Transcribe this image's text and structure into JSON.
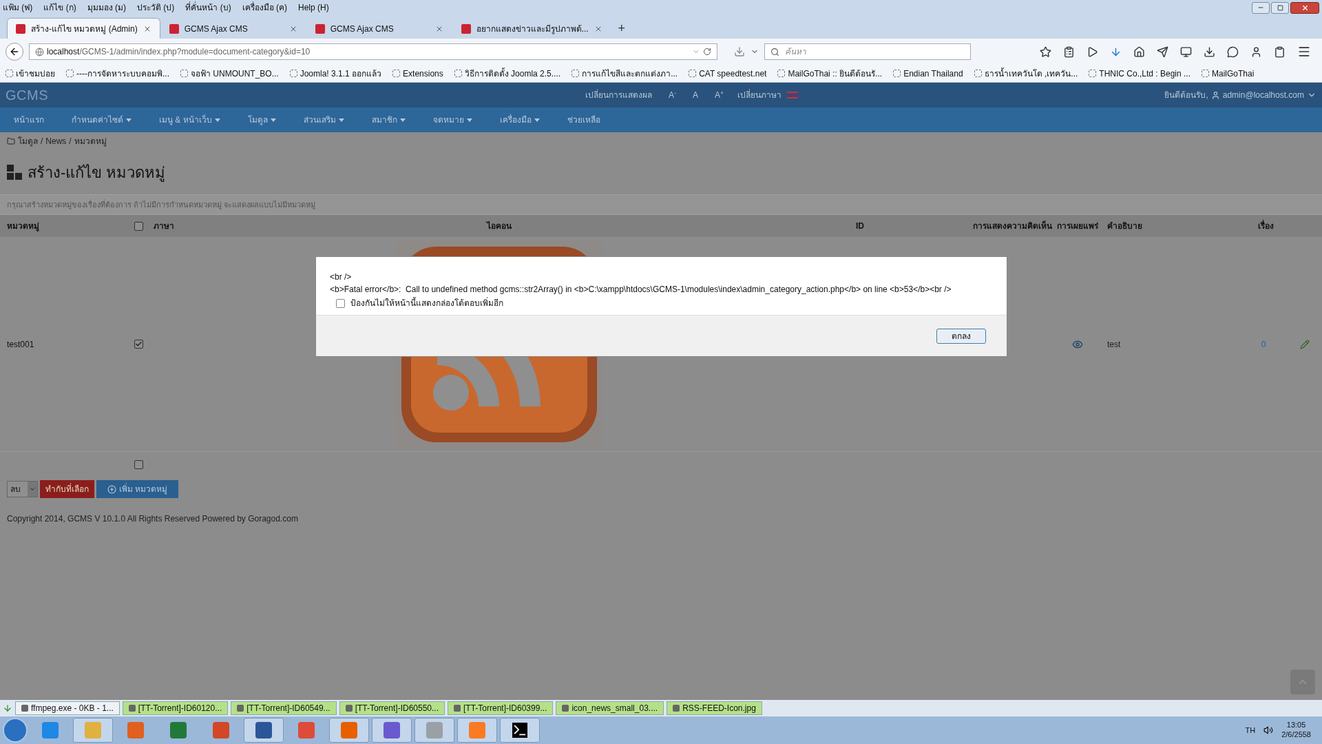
{
  "menubar": [
    "แฟ้ม (ฟ)",
    "แก้ไข (ก)",
    "มุมมอง (ม)",
    "ประวัติ (ป)",
    "ที่คั่นหน้า (บ)",
    "เครื่องมือ (ค)",
    "Help (H)"
  ],
  "tabs": [
    {
      "label": "สร้าง-แก้ไข หมวดหมู่ (Admin)",
      "selected": true
    },
    {
      "label": "GCMS Ajax CMS",
      "selected": false
    },
    {
      "label": "GCMS Ajax CMS",
      "selected": false
    },
    {
      "label": "อยากแสดงข่าวและมีรูปภาพด้...",
      "selected": false
    }
  ],
  "new_tab": "+",
  "address": {
    "host": "localhost",
    "path": "/GCMS-1/admin/index.php?module=document-category&id=10"
  },
  "search": {
    "placeholder": "ค้นหา"
  },
  "bookmarks": [
    "เข้าชมบ่อย",
    "----การจัดหาระบบคอมพิ...",
    "จอฟ้า UNMOUNT_BO...",
    "Joomla! 3.1.1 ออกแล้ว",
    "Extensions",
    "วิธีการติดตั้ง Joomla 2.5....",
    "การแก้ไขสีและตกแต่งภา...",
    "CAT speedtest.net",
    "MailGoThai :: ยินดีต้อนรั...",
    "Endian Thailand",
    "ธารน้ำเทควันโด ,เทควัน...",
    "THNIC Co.,Ltd : Begin ...",
    "MailGoThai"
  ],
  "site": {
    "logo": "GCMS",
    "display_label": "เปลี่ยนการแสดงผล",
    "sizes": [
      "A$^{-}$",
      "A",
      "A$^{+}$"
    ],
    "language_label": "เปลี่ยนภาษา",
    "welcome": "ยินดีต้อนรับ,",
    "user": "admin@localhost.com"
  },
  "nav": [
    {
      "label": "หน้าแรก",
      "dropdown": false
    },
    {
      "label": "กำหนดค่าไซต์",
      "dropdown": true
    },
    {
      "label": "เมนู & หน้าเว็บ",
      "dropdown": true
    },
    {
      "label": "โมดูล",
      "dropdown": true
    },
    {
      "label": "ส่วนเสริม",
      "dropdown": true
    },
    {
      "label": "สมาชิก",
      "dropdown": true
    },
    {
      "label": "จดหมาย",
      "dropdown": true
    },
    {
      "label": "เครื่องมือ",
      "dropdown": true
    },
    {
      "label": "ช่วยเหลือ",
      "dropdown": false
    }
  ],
  "breadcrumb": {
    "items": [
      "โมดูล",
      "News",
      "หมวดหมู่"
    ],
    "separator": "/"
  },
  "title": "สร้าง-แก้ไข หมวดหมู่",
  "hint": "กรุณาสร้างหมวดหมู่ของเรื่องที่ต้องการ ถ้าไม่มีการกำหนดหมวดหมู่ จะแสดงผลแบบไม่มีหมวดหมู่",
  "table": {
    "columns": [
      "หมวดหมู่",
      "ภาษา",
      "ไอคอน",
      "ID",
      "การแสดงความคิดเห็น",
      "การเผยแพร่",
      "คำอธิบาย",
      "เรื่อง"
    ],
    "select_all_checked": false,
    "rows": [
      {
        "name": "test001",
        "checked": true,
        "published": true,
        "description": "test",
        "count": "0"
      }
    ],
    "footer_checked": false
  },
  "actions": {
    "select_value": "ลบ",
    "apply": "ทำกับที่เลือก",
    "add": "เพิ่ม หมวดหมู่"
  },
  "copyright": "Copyright 2014, GCMS V 10.1.0 All Rights Reserved Powered by Goragod.com",
  "dialog": {
    "lines": [
      "<br />",
      "<b>Fatal error</b>:  Call to undefined method gcms::str2Array() in <b>C:\\xampp\\htdocs\\GCMS-1\\modules\\index\\admin_category_action.php</b> on line <b>53</b><br />"
    ],
    "suppress_label": "ป้องกันไม่ให้หน้านี้แสดงกล่องโต้ตอบเพิ่มอีก",
    "suppress_checked": false,
    "ok": "ตกลง"
  },
  "downloads": [
    "ffmpeg.exe - 0KB - 1...",
    "[TT-Torrent]-ID60120...",
    "[TT-Torrent]-ID60549...",
    "[TT-Torrent]-ID60550...",
    "[TT-Torrent]-ID60399...",
    "icon_news_small_03....",
    "RSS-FEED-Icon.jpg"
  ],
  "taskbar": {
    "apps": [
      {
        "kind": "ie",
        "active": false
      },
      {
        "kind": "folder",
        "active": true
      },
      {
        "kind": "media",
        "active": false
      },
      {
        "kind": "excel",
        "active": false
      },
      {
        "kind": "powerpoint",
        "active": false
      },
      {
        "kind": "word",
        "active": true
      },
      {
        "kind": "chrome",
        "active": false
      },
      {
        "kind": "firefox",
        "active": true
      },
      {
        "kind": "torrent",
        "active": true
      },
      {
        "kind": "tool",
        "active": true
      },
      {
        "kind": "xampp",
        "active": true
      },
      {
        "kind": "console",
        "active": true
      }
    ],
    "language": "TH",
    "time": "13:05",
    "date": "2/6/2558"
  }
}
